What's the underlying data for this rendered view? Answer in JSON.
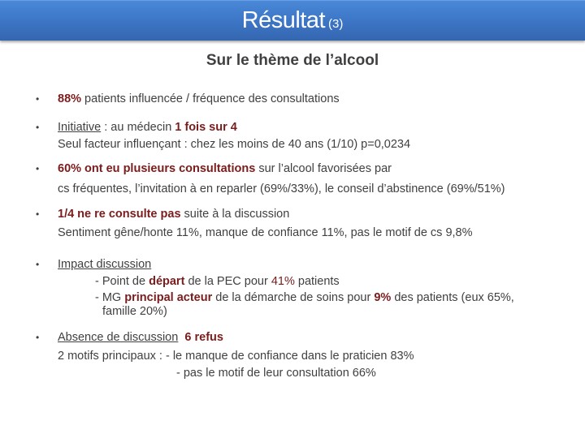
{
  "header": {
    "title": "Résultat",
    "title_number": "(3)"
  },
  "subtitle": "Sur le thème de l’alcool",
  "bullet_glyph": "•",
  "bullets": [
    {
      "highlight": "88%",
      "text": " patients influencée / fréquence des consultations"
    },
    {
      "label": "Initiative",
      "text": " : au médecin ",
      "highlight": "1 fois sur 4",
      "line2": "Seul facteur influençant : chez les moins de 40 ans (1/10) p=0,0234"
    },
    {
      "highlight": "60% ont eu plusieurs consultations",
      "text": " sur l’alcool favorisées par",
      "line2": "cs fréquentes, l’invitation à en reparler (69%/33%), le conseil d’abstinence (69%/51%)"
    },
    {
      "highlight": "1/4 ne re consulte pas",
      "text": " suite à la discussion",
      "line2": "Sentiment gêne/honte 11%, manque de confiance 11%, pas le motif de cs 9,8%"
    },
    {
      "label": "Impact discussion",
      "sub1": {
        "prefix": "- Point de ",
        "bold": "départ",
        "mid": " de la PEC pour ",
        "red": "41%",
        "suffix": " patients"
      },
      "sub2": {
        "prefix": "- MG ",
        "bold": "principal acteur",
        "mid": " de la démarche de soins pour ",
        "bold2": "9%",
        "suffix": " des patients (eux 65%,",
        "cont": "famille 20%)"
      }
    },
    {
      "label": "Absence de discussion",
      "highlight": "6 refus",
      "line2": "2 motifs principaux : - le manque de confiance dans le praticien 83%",
      "line3": "- pas le motif de leur consultation 66%"
    }
  ],
  "colors": {
    "accent_red": "#7a1c1c",
    "header_blue": "#3d76c6",
    "text": "#404040"
  }
}
